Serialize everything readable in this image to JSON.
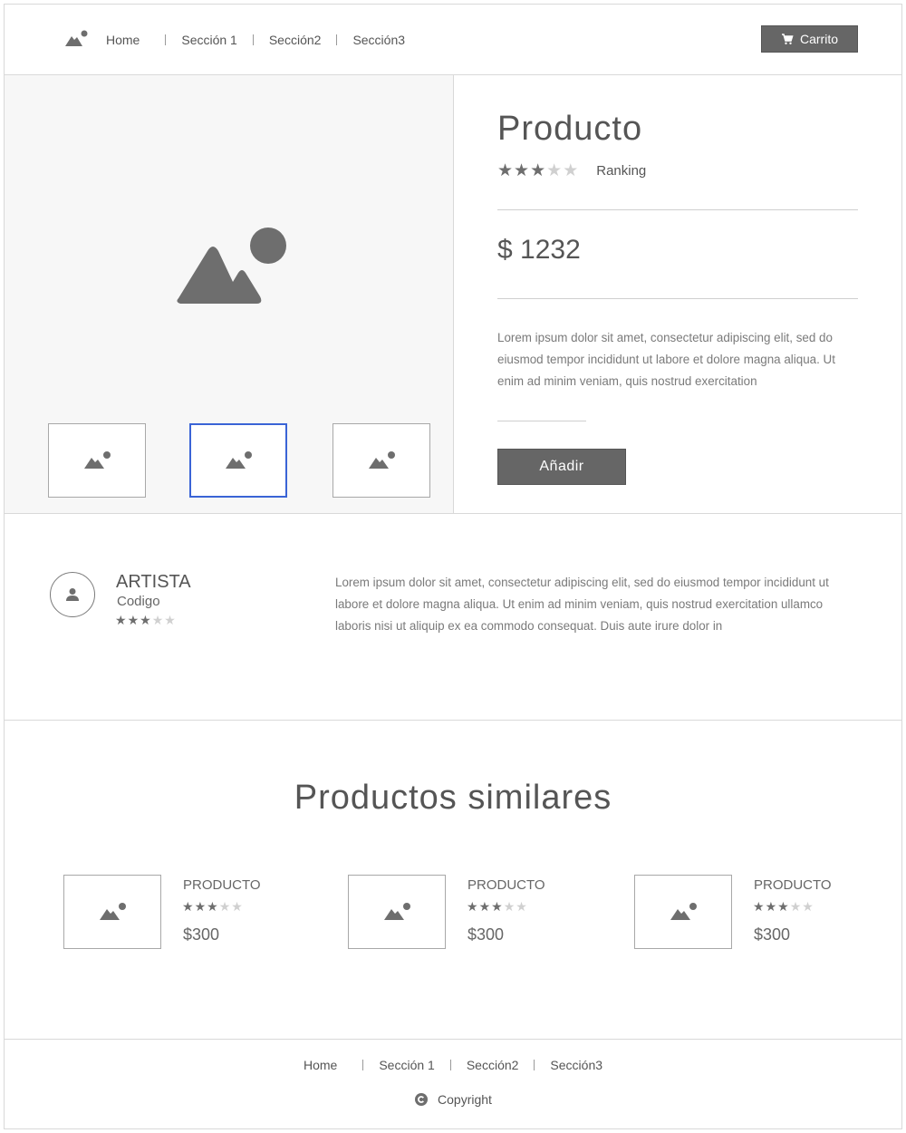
{
  "header": {
    "logo_icon": "image-icon",
    "nav": [
      "Home",
      "Sección 1",
      "Sección2",
      "Sección3"
    ],
    "cart_label": "Carrito",
    "cart_icon": "cart-icon"
  },
  "product": {
    "title": "Producto",
    "rating": 3,
    "rating_max": 5,
    "rating_label": "Ranking",
    "price": "$ 1232",
    "description": "Lorem ipsum dolor sit amet, consectetur adipiscing elit, sed do eiusmod tempor incididunt ut labore et dolore magna aliqua. Ut enim ad minim veniam, quis nostrud exercitation",
    "add_label": "Añadir",
    "thumbnails": [
      {
        "selected": false
      },
      {
        "selected": true
      },
      {
        "selected": false
      }
    ]
  },
  "artist": {
    "name": "ARTISTA",
    "code": "Codigo",
    "rating": 3,
    "description": "Lorem ipsum dolor sit amet, consectetur adipiscing elit, sed do eiusmod tempor incididunt ut labore et dolore magna aliqua. Ut enim ad minim veniam, quis nostrud exercitation ullamco laboris nisi ut aliquip ex ea commodo consequat. Duis aute irure dolor in"
  },
  "similar": {
    "title": "Productos similares",
    "items": [
      {
        "name": "PRODUCTO",
        "rating": 3,
        "price": "$300"
      },
      {
        "name": "PRODUCTO",
        "rating": 3,
        "price": "$300"
      },
      {
        "name": "PRODUCTO",
        "rating": 3,
        "price": "$300"
      }
    ]
  },
  "footer": {
    "nav": [
      "Home",
      "Sección 1",
      "Sección2",
      "Sección3"
    ],
    "copyright": "Copyright",
    "copyright_icon": "copyright-icon"
  },
  "colors": {
    "accent_selected": "#3a64d6",
    "button": "#666666",
    "placeholder": "#6e6e6e"
  }
}
